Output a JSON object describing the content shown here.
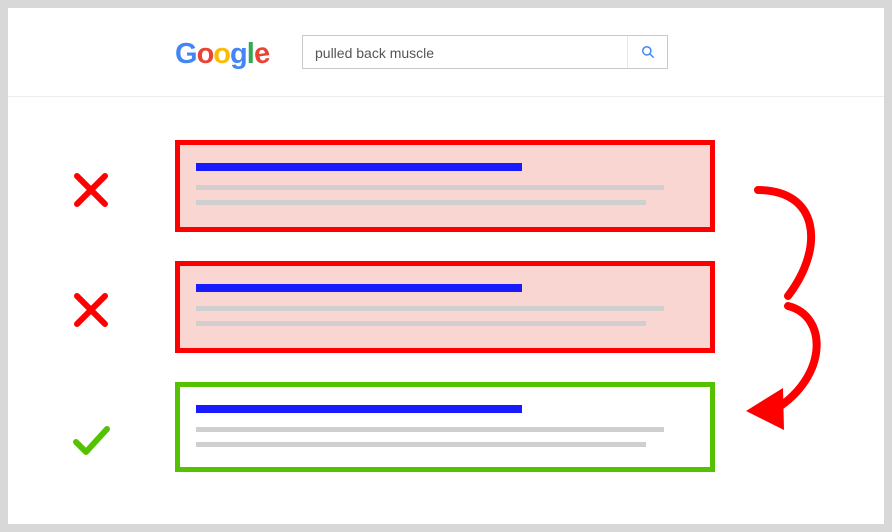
{
  "logo": {
    "g1": "G",
    "o1": "o",
    "o2": "o",
    "g2": "g",
    "l": "l",
    "e": "e"
  },
  "search": {
    "query": "pulled back muscle",
    "icon_name": "magnifying-glass"
  },
  "results": [
    {
      "status": "rejected",
      "mark": "cross",
      "border_color": "#FF0000",
      "fill_color": "rgba(234,67,53,0.22)"
    },
    {
      "status": "rejected",
      "mark": "cross",
      "border_color": "#FF0000",
      "fill_color": "rgba(234,67,53,0.22)"
    },
    {
      "status": "accepted",
      "mark": "check",
      "border_color": "#54c200",
      "fill_color": "#ffffff"
    }
  ],
  "colors": {
    "title_bar": "#1a1aff",
    "snippet_line": "#cfcfcf",
    "cross": "#FF0000",
    "check": "#54c200",
    "arrow": "#FF0000"
  },
  "diagram": {
    "meaning": "Skip the first two search results and choose the third one",
    "arrows_from_to": [
      [
        0,
        1
      ],
      [
        1,
        2
      ]
    ]
  }
}
